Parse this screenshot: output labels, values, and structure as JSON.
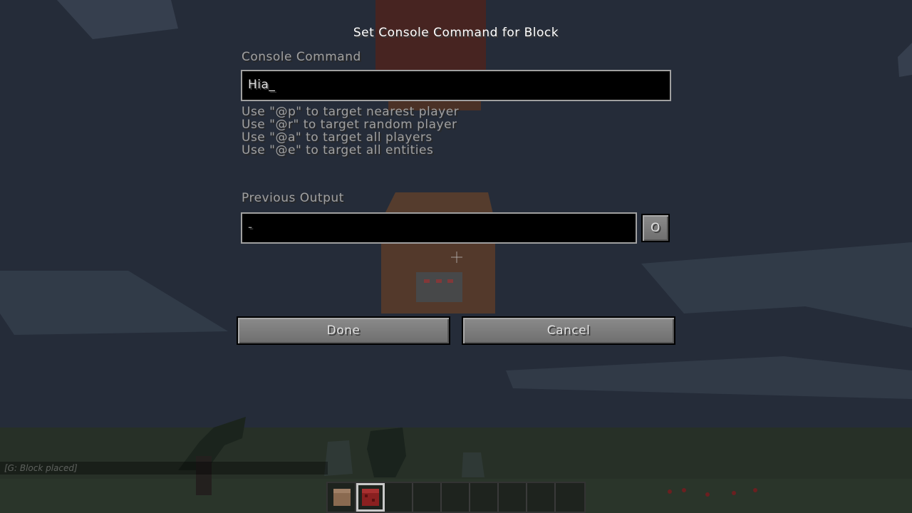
{
  "screen": {
    "title": "Set Console Command for Block",
    "command_label": "Console Command",
    "command_value": "Hia_",
    "hints": [
      "Use \"@p\" to target nearest player",
      "Use \"@r\" to target random player",
      "Use \"@a\" to target all players",
      "Use \"@e\" to target all entities"
    ],
    "output_label": "Previous Output",
    "output_value": "-",
    "output_toggle": "O",
    "done_label": "Done",
    "cancel_label": "Cancel"
  },
  "hud": {
    "chat_message": "[G: Block placed]",
    "hotbar_slot_count": 9,
    "hotbar_selected_slot": 2,
    "hotbar_items": [
      "command-block",
      "redstone-block",
      "",
      "",
      "",
      "",
      "",
      "",
      ""
    ]
  },
  "colors": {
    "sky": "#2c3545",
    "text": "#e0e0e0",
    "label": "#a0a0a0",
    "field_bg": "#000000",
    "field_border": "#a0a0a0"
  }
}
